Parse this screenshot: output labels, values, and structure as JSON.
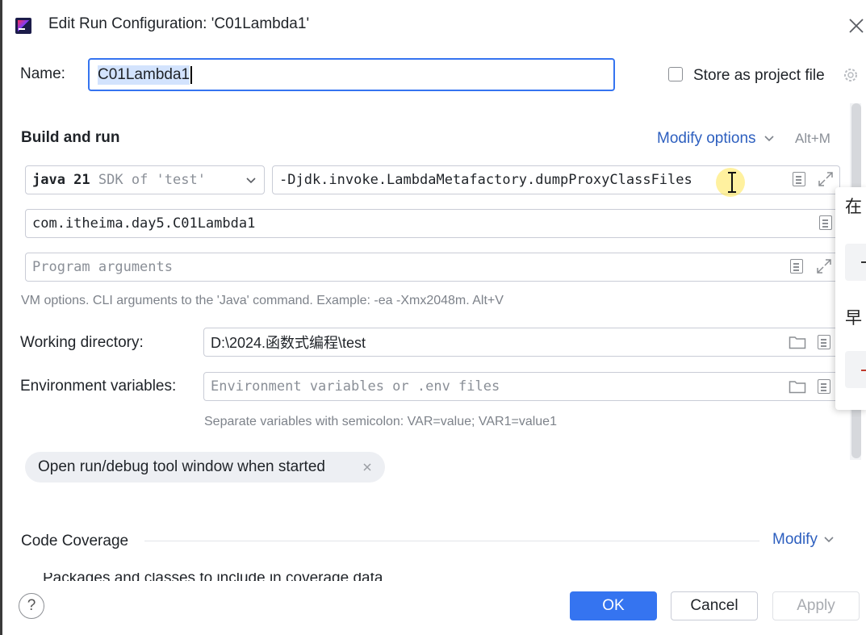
{
  "window": {
    "title": "Edit Run Configuration: 'C01Lambda1'"
  },
  "name_row": {
    "label": "Name:",
    "value": "C01Lambda1",
    "store_label": "Store as project file",
    "store_checked": false
  },
  "build_run": {
    "title": "Build and run",
    "modify_options": "Modify options",
    "modify_shortcut": "Alt+M",
    "jdk_bold": "java 21",
    "jdk_rest": "SDK of 'test'",
    "vm_options": "-Djdk.invoke.LambdaMetafactory.dumpProxyClassFiles",
    "main_class": "com.itheima.day5.C01Lambda1",
    "program_args_placeholder": "Program arguments",
    "vm_hint": "VM options. CLI arguments to the 'Java' command. Example: -ea -Xmx2048m. Alt+V"
  },
  "working_dir": {
    "label": "Working directory:",
    "value": "D:\\2024.函数式编程\\test"
  },
  "env_vars": {
    "label": "Environment variables:",
    "placeholder": "Environment variables or .env files",
    "hint": "Separate variables with semicolon: VAR=value; VAR1=value1"
  },
  "chip": {
    "label": "Open run/debug tool window when started"
  },
  "code_coverage": {
    "title": "Code Coverage",
    "modify": "Modify",
    "cut_text": "Packages and classes to include in coverage data"
  },
  "popup": {
    "char1": "在",
    "char2": "早",
    "dash_color": "#c0392b"
  },
  "footer": {
    "help": "?",
    "ok": "OK",
    "cancel": "Cancel",
    "apply": "Apply"
  },
  "colors": {
    "accent": "#3574f0",
    "link": "#2d5fbf"
  }
}
